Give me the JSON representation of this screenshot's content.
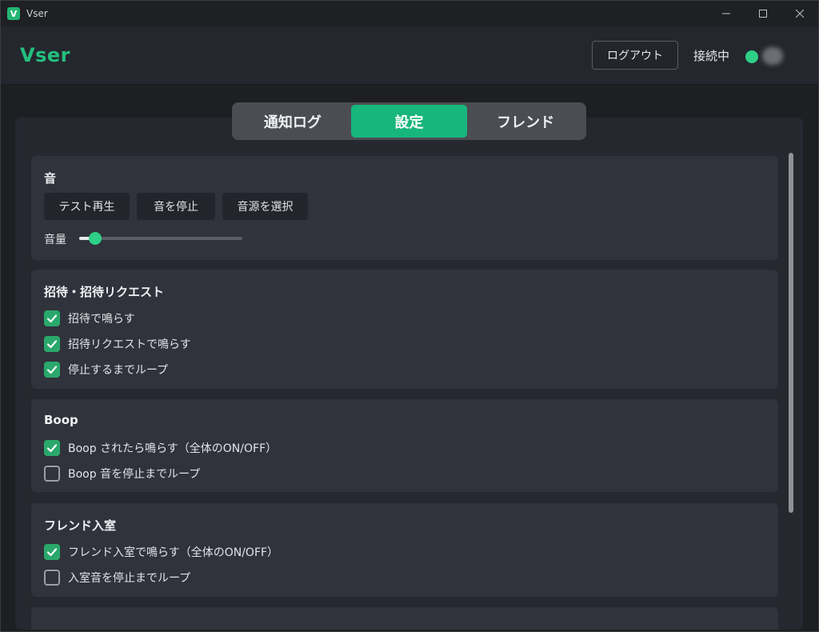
{
  "window": {
    "title": "Vser"
  },
  "header": {
    "brand": "Vser",
    "logout_label": "ログアウト",
    "connection_status": "接続中",
    "status_color": "#2ecf86"
  },
  "tabs": [
    {
      "label": "通知ログ",
      "active": false
    },
    {
      "label": "設定",
      "active": true
    },
    {
      "label": "フレンド",
      "active": false
    }
  ],
  "sound": {
    "title": "音",
    "buttons": [
      "テスト再生",
      "音を停止",
      "音源を選択"
    ],
    "volume_label": "音量",
    "volume_fraction": 0.1
  },
  "invite": {
    "title": "招待・招待リクエスト",
    "options": [
      {
        "label": "招待で鳴らす",
        "checked": true
      },
      {
        "label": "招待リクエストで鳴らす",
        "checked": true
      },
      {
        "label": "停止するまでループ",
        "checked": true
      }
    ]
  },
  "boop": {
    "title": "Boop",
    "options": [
      {
        "label": "Boop されたら鳴らす（全体のON/OFF）",
        "checked": true
      },
      {
        "label": "Boop 音を停止までループ",
        "checked": false
      }
    ]
  },
  "friend_join": {
    "title": "フレンド入室",
    "options": [
      {
        "label": "フレンド入室で鳴らす（全体のON/OFF）",
        "checked": true
      },
      {
        "label": "入室音を停止までループ",
        "checked": false
      }
    ]
  },
  "accent_color": "#17b67d"
}
